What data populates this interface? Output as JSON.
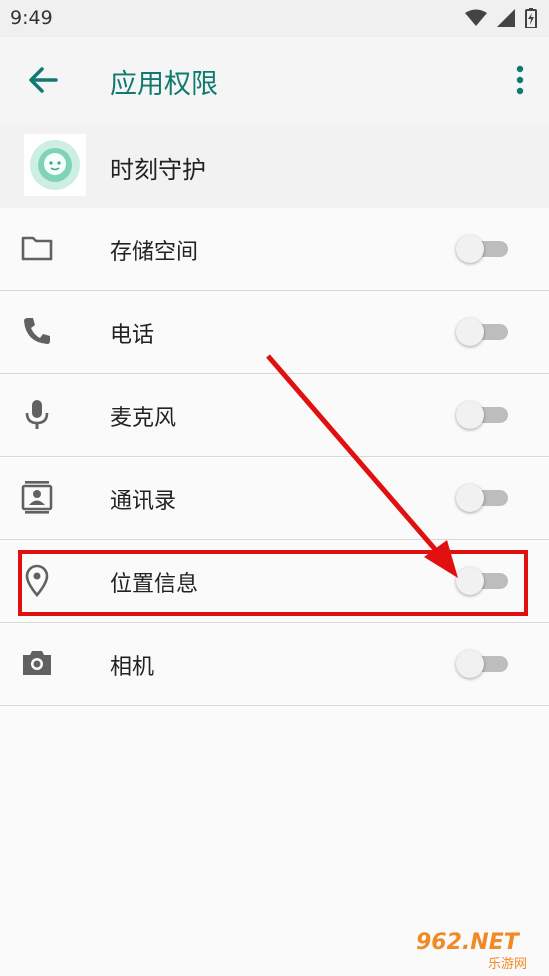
{
  "status_bar": {
    "time": "9:49",
    "icons": [
      "wifi-icon",
      "signal-icon",
      "battery-icon"
    ]
  },
  "app_bar": {
    "title": "应用权限",
    "back_icon": "arrow-back-icon",
    "menu_icon": "more-vert-icon"
  },
  "app": {
    "name": "时刻守护"
  },
  "permissions": [
    {
      "label": "存储空间",
      "icon": "folder-icon",
      "enabled": false
    },
    {
      "label": "电话",
      "icon": "phone-icon",
      "enabled": false
    },
    {
      "label": "麦克风",
      "icon": "microphone-icon",
      "enabled": false
    },
    {
      "label": "通讯录",
      "icon": "contacts-icon",
      "enabled": false
    },
    {
      "label": "位置信息",
      "icon": "location-icon",
      "enabled": false
    },
    {
      "label": "相机",
      "icon": "camera-icon",
      "enabled": false
    }
  ],
  "annotation": {
    "highlight_color": "#e01010"
  },
  "watermark": {
    "text": "962.NET",
    "subtext": "乐游网"
  },
  "colors": {
    "accent": "#0f7a70",
    "switch_track": "#bdbdbd",
    "switch_thumb": "#f1f1f1"
  }
}
